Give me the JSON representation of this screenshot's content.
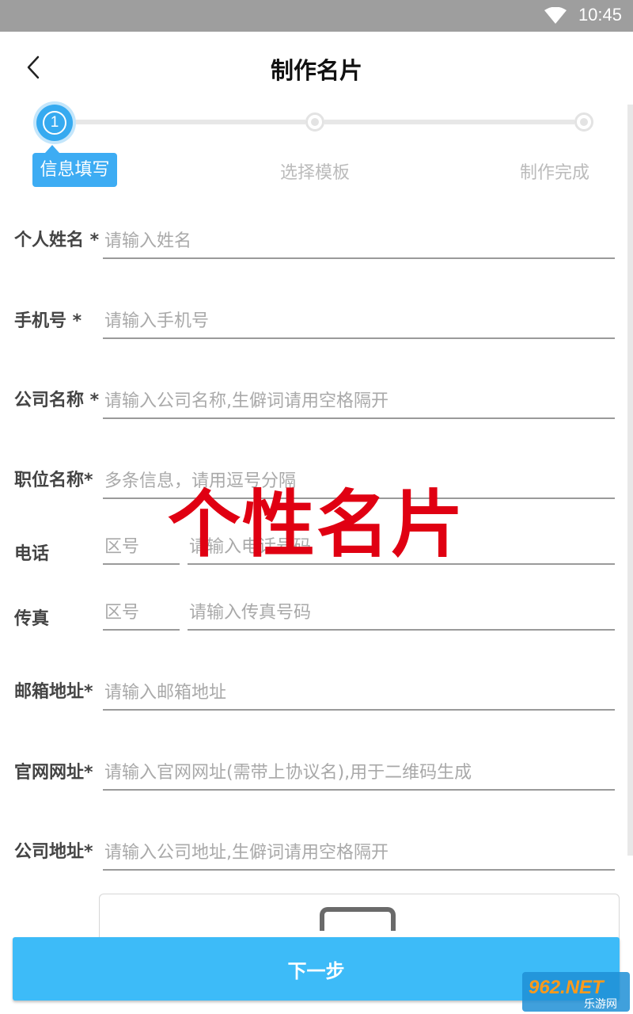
{
  "status_bar": {
    "time": "10:45",
    "wifi_icon": "wifi-icon"
  },
  "header": {
    "title": "制作名片",
    "back_icon": "chevron-left-icon"
  },
  "stepper": {
    "current_step": "1",
    "steps": [
      {
        "label": "信息填写",
        "state": "active"
      },
      {
        "label": "选择模板",
        "state": "inactive"
      },
      {
        "label": "制作完成",
        "state": "inactive"
      }
    ],
    "active_color": "#36aaf0"
  },
  "form": {
    "name": {
      "label": "个人姓名 *",
      "placeholder": "请输入姓名",
      "value": ""
    },
    "phone": {
      "label": "手机号 *",
      "placeholder": "请输入手机号",
      "value": ""
    },
    "company": {
      "label": "公司名称 *",
      "placeholder": "请输入公司名称,生僻词请用空格隔开",
      "value": ""
    },
    "position": {
      "label": "职位名称*",
      "placeholder": "多条信息，请用逗号分隔",
      "value": ""
    },
    "tel": {
      "label": "电话",
      "area_placeholder": "区号",
      "number_placeholder": "请输入电话号码"
    },
    "fax": {
      "label": "传真",
      "area_placeholder": "区号",
      "number_placeholder": "请输入传真号码"
    },
    "email": {
      "label": "邮箱地址*",
      "placeholder": "请输入邮箱地址",
      "value": ""
    },
    "website": {
      "label": "官网网址*",
      "placeholder": "请输入官网网址(需带上协议名),用于二维码生成",
      "value": ""
    },
    "address": {
      "label": "公司地址*",
      "placeholder": "请输入公司地址,生僻词请用空格隔开",
      "value": ""
    }
  },
  "watermark": {
    "text": "个性名片",
    "color": "#e00012"
  },
  "upload": {
    "icon": "upload-frame-icon"
  },
  "footer": {
    "next_label": "下一步",
    "button_color": "#3dbbf8"
  },
  "brand": {
    "logo_text": "962.NET",
    "sub_text": "乐游网"
  }
}
